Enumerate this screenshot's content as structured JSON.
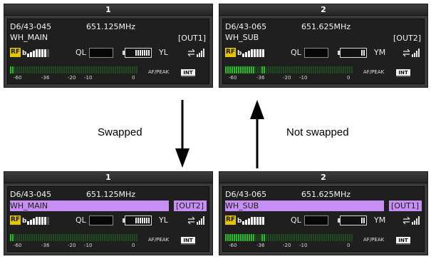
{
  "top_panels": [
    {
      "header": "1",
      "device": "D6/43-045",
      "freq": "651.125MHz",
      "name": "WH_MAIN",
      "out": "[OUT1]",
      "rf_badge": "RF",
      "rf_sub": "b",
      "ql_label": "QL",
      "antenna": "L",
      "af_label": "AF/PEAK",
      "int_badge": "INT",
      "scale": [
        "-60",
        "-36",
        "-20",
        "-10",
        "0"
      ]
    },
    {
      "header": "2",
      "device": "D6/43-065",
      "freq": "651.625MHz",
      "name": "WH_SUB",
      "out": "[OUT2]",
      "rf_badge": "RF",
      "rf_sub": "b",
      "ql_label": "QL",
      "antenna": "M",
      "af_label": "AF/PEAK",
      "int_badge": "INT",
      "scale": [
        "-60",
        "-36",
        "-20",
        "-10",
        "0"
      ]
    }
  ],
  "bottom_panels": [
    {
      "header": "1",
      "device": "D6/43-045",
      "freq": "651.125MHz",
      "name": "WH_MAIN",
      "out": "[OUT2]",
      "rf_badge": "RF",
      "rf_sub": "b",
      "ql_label": "QL",
      "antenna": "L",
      "af_label": "AF/PEAK",
      "int_badge": "INT",
      "scale": [
        "-60",
        "-36",
        "-20",
        "-10",
        "0"
      ]
    },
    {
      "header": "2",
      "device": "D6/43-065",
      "freq": "651.625MHz",
      "name": "WH_SUB",
      "out": "[OUT1]",
      "rf_badge": "RF",
      "rf_sub": "b",
      "ql_label": "QL",
      "antenna": "M",
      "af_label": "AF/PEAK",
      "int_badge": "INT",
      "scale": [
        "-60",
        "-36",
        "-20",
        "-10",
        "0"
      ]
    }
  ],
  "labels": {
    "swapped": "Swapped",
    "not_swapped": "Not swapped"
  },
  "icons": {
    "rf_badge": "rf-badge-icon",
    "antenna": "antenna-icon",
    "link": "link-signal-icon",
    "battery": "battery-icon"
  },
  "colors": {
    "highlight": "#c78ff3",
    "rf_badge": "#e5c400",
    "meter_on": "#22c022"
  },
  "levels": {
    "battery_bars": {
      "panel1": 5,
      "panel2": 2
    },
    "rf_bars": {
      "panel1": 7,
      "panel2": 8
    },
    "af_meter": {
      "panel1": 0.05,
      "panel2": 0.35
    }
  }
}
